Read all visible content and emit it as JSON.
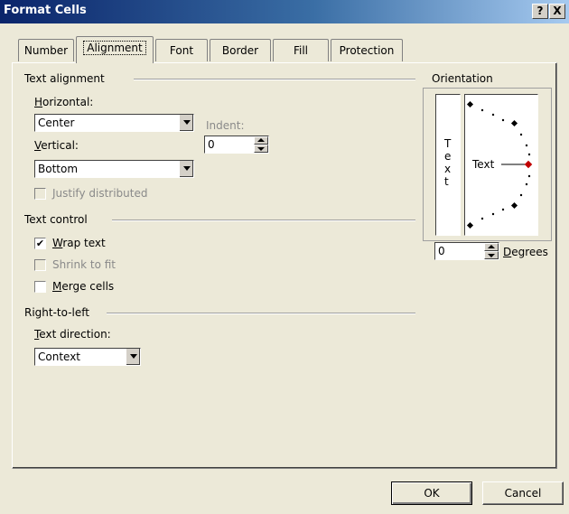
{
  "window": {
    "title": "Format Cells",
    "help_label": "?",
    "close_label": "X"
  },
  "tabs": [
    {
      "label": "Number"
    },
    {
      "label": "Alignment"
    },
    {
      "label": "Font"
    },
    {
      "label": "Border"
    },
    {
      "label": "Fill"
    },
    {
      "label": "Protection"
    }
  ],
  "text_alignment": {
    "header": "Text alignment",
    "horizontal_label": "Horizontal:",
    "horizontal_value": "Center",
    "indent_label": "Indent:",
    "indent_value": "0",
    "vertical_label": "Vertical:",
    "vertical_value": "Bottom",
    "justify_label": "Justify distributed"
  },
  "text_control": {
    "header": "Text control",
    "wrap_label": "Wrap text",
    "wrap_checked": "✔",
    "shrink_label": "Shrink to fit",
    "merge_label": "Merge cells"
  },
  "rtl": {
    "header": "Right-to-left",
    "direction_label": "Text direction:",
    "direction_value": "Context"
  },
  "orientation": {
    "header": "Orientation",
    "vertical_chars": [
      "T",
      "e",
      "x",
      "t"
    ],
    "dial_label": "Text",
    "degrees_value": "0",
    "degrees_label": "Degrees",
    "accent": "#c00000"
  },
  "footer": {
    "ok_label": "OK",
    "cancel_label": "Cancel"
  }
}
